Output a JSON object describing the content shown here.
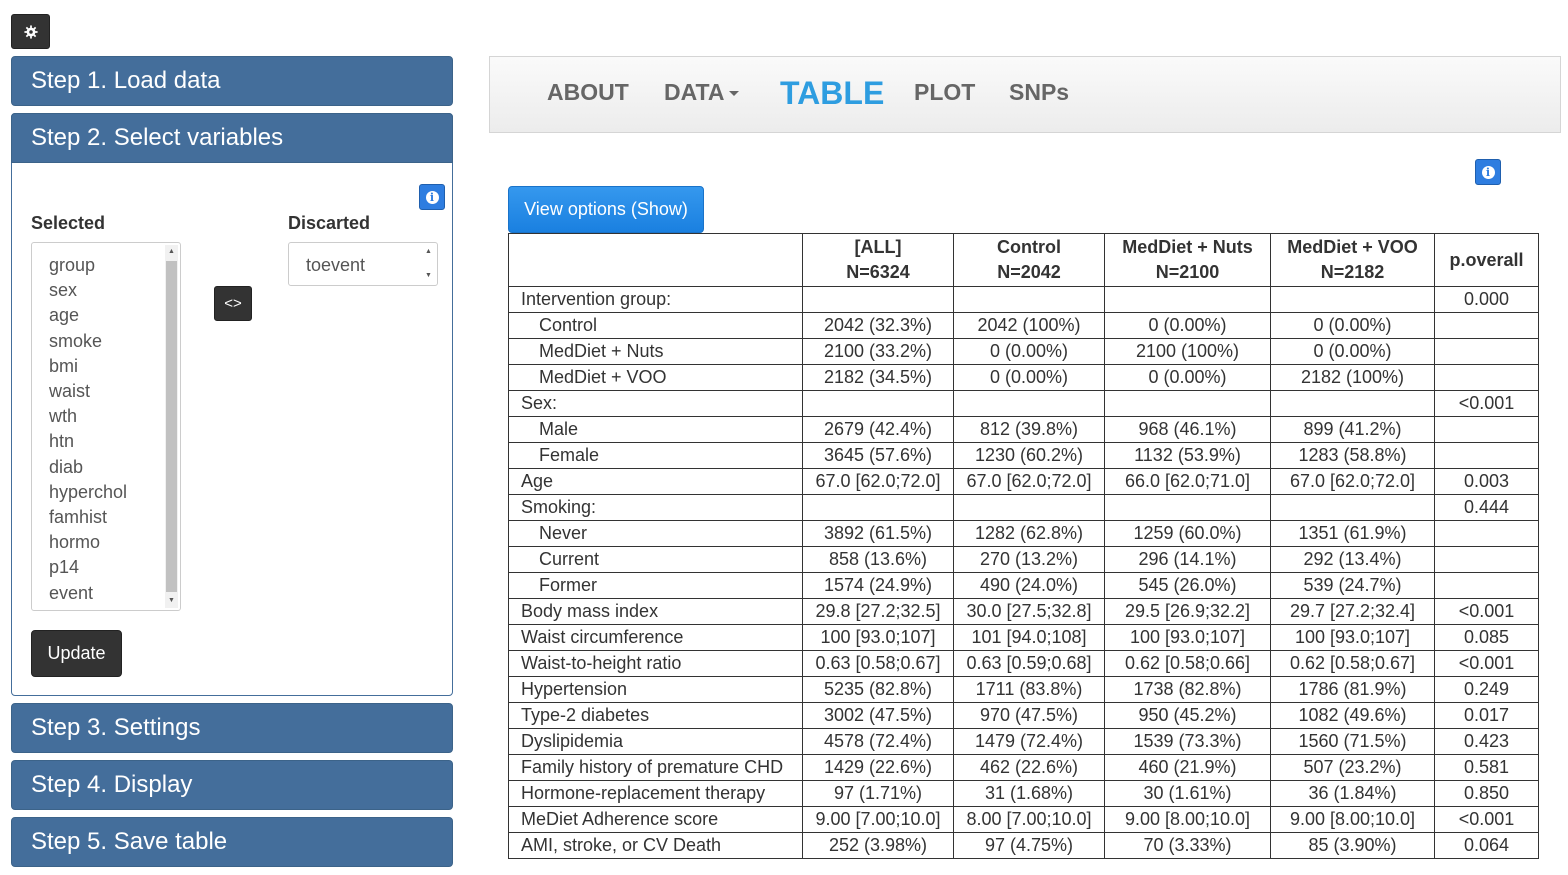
{
  "sidebar": {
    "steps": [
      "Step 1. Load data",
      "Step 2. Select variables",
      "Step 3. Settings",
      "Step 4. Display",
      "Step 5. Save table"
    ],
    "selected_label": "Selected",
    "discarded_label": "Discarted",
    "selected_items": [
      "group",
      "sex",
      "age",
      "smoke",
      "bmi",
      "waist",
      "wth",
      "htn",
      "diab",
      "hyperchol",
      "famhist",
      "hormo",
      "p14",
      "event"
    ],
    "discarded_items": [
      "toevent"
    ],
    "swap_label": "<>",
    "update_label": "Update"
  },
  "nav": {
    "items": [
      {
        "label": "ABOUT"
      },
      {
        "label": "DATA"
      },
      {
        "label": "TABLE",
        "active": true
      },
      {
        "label": "PLOT"
      },
      {
        "label": "SNPs"
      }
    ]
  },
  "main": {
    "view_options_label": "View options (Show)",
    "table": {
      "headers": [
        {
          "line1": "",
          "line2": ""
        },
        {
          "line1": "[ALL]",
          "line2": "N=6324"
        },
        {
          "line1": "Control",
          "line2": "N=2042"
        },
        {
          "line1": "MedDiet + Nuts",
          "line2": "N=2100"
        },
        {
          "line1": "MedDiet + VOO",
          "line2": "N=2182"
        },
        {
          "line1": "p.overall",
          "line2": ""
        }
      ],
      "rows": [
        {
          "label": "Intervention group:",
          "indent": false,
          "cells": [
            "",
            "",
            "",
            "",
            "0.000"
          ]
        },
        {
          "label": "Control",
          "indent": true,
          "cells": [
            "2042 (32.3%)",
            "2042 (100%)",
            "0 (0.00%)",
            "0 (0.00%)",
            ""
          ]
        },
        {
          "label": "MedDiet + Nuts",
          "indent": true,
          "cells": [
            "2100 (33.2%)",
            "0 (0.00%)",
            "2100 (100%)",
            "0 (0.00%)",
            ""
          ]
        },
        {
          "label": "MedDiet + VOO",
          "indent": true,
          "cells": [
            "2182 (34.5%)",
            "0 (0.00%)",
            "0 (0.00%)",
            "2182 (100%)",
            ""
          ]
        },
        {
          "label": "Sex:",
          "indent": false,
          "cells": [
            "",
            "",
            "",
            "",
            "<0.001"
          ]
        },
        {
          "label": "Male",
          "indent": true,
          "cells": [
            "2679 (42.4%)",
            "812 (39.8%)",
            "968 (46.1%)",
            "899 (41.2%)",
            ""
          ]
        },
        {
          "label": "Female",
          "indent": true,
          "cells": [
            "3645 (57.6%)",
            "1230 (60.2%)",
            "1132 (53.9%)",
            "1283 (58.8%)",
            ""
          ]
        },
        {
          "label": "Age",
          "indent": false,
          "cells": [
            "67.0 [62.0;72.0]",
            "67.0 [62.0;72.0]",
            "66.0 [62.0;71.0]",
            "67.0 [62.0;72.0]",
            "0.003"
          ]
        },
        {
          "label": "Smoking:",
          "indent": false,
          "cells": [
            "",
            "",
            "",
            "",
            "0.444"
          ]
        },
        {
          "label": "Never",
          "indent": true,
          "cells": [
            "3892 (61.5%)",
            "1282 (62.8%)",
            "1259 (60.0%)",
            "1351 (61.9%)",
            ""
          ]
        },
        {
          "label": "Current",
          "indent": true,
          "cells": [
            "858 (13.6%)",
            "270 (13.2%)",
            "296 (14.1%)",
            "292 (13.4%)",
            ""
          ]
        },
        {
          "label": "Former",
          "indent": true,
          "cells": [
            "1574 (24.9%)",
            "490 (24.0%)",
            "545 (26.0%)",
            "539 (24.7%)",
            ""
          ]
        },
        {
          "label": "Body mass index",
          "indent": false,
          "cells": [
            "29.8 [27.2;32.5]",
            "30.0 [27.5;32.8]",
            "29.5 [26.9;32.2]",
            "29.7 [27.2;32.4]",
            "<0.001"
          ]
        },
        {
          "label": "Waist circumference",
          "indent": false,
          "cells": [
            "100 [93.0;107]",
            "101 [94.0;108]",
            "100 [93.0;107]",
            "100 [93.0;107]",
            "0.085"
          ]
        },
        {
          "label": "Waist-to-height ratio",
          "indent": false,
          "cells": [
            "0.63 [0.58;0.67]",
            "0.63 [0.59;0.68]",
            "0.62 [0.58;0.66]",
            "0.62 [0.58;0.67]",
            "<0.001"
          ]
        },
        {
          "label": "Hypertension",
          "indent": false,
          "cells": [
            "5235 (82.8%)",
            "1711 (83.8%)",
            "1738 (82.8%)",
            "1786 (81.9%)",
            "0.249"
          ]
        },
        {
          "label": "Type-2 diabetes",
          "indent": false,
          "cells": [
            "3002 (47.5%)",
            "970 (47.5%)",
            "950 (45.2%)",
            "1082 (49.6%)",
            "0.017"
          ]
        },
        {
          "label": "Dyslipidemia",
          "indent": false,
          "cells": [
            "4578 (72.4%)",
            "1479 (72.4%)",
            "1539 (73.3%)",
            "1560 (71.5%)",
            "0.423"
          ]
        },
        {
          "label": "Family history of premature CHD",
          "indent": false,
          "cells": [
            "1429 (22.6%)",
            "462 (22.6%)",
            "460 (21.9%)",
            "507 (23.2%)",
            "0.581"
          ]
        },
        {
          "label": "Hormone-replacement therapy",
          "indent": false,
          "cells": [
            "97 (1.71%)",
            "31 (1.68%)",
            "30 (1.61%)",
            "36 (1.84%)",
            "0.850"
          ]
        },
        {
          "label": "MeDiet Adherence score",
          "indent": false,
          "cells": [
            "9.00 [7.00;10.0]",
            "8.00 [7.00;10.0]",
            "9.00 [8.00;10.0]",
            "9.00 [8.00;10.0]",
            "<0.001"
          ]
        },
        {
          "label": "AMI, stroke, or CV Death",
          "indent": false,
          "cells": [
            "252 (3.98%)",
            "97 (4.75%)",
            "70 (3.33%)",
            "85 (3.90%)",
            "0.064"
          ]
        }
      ]
    }
  },
  "colors": {
    "step_header": "#446e9b",
    "nav_active": "#2e9de0",
    "primary_button": "#1a80e0",
    "dark_button": "#333333"
  },
  "icons": {
    "settings": "gear-icon",
    "info": "info-icon",
    "dropdown": "caret-down-icon"
  }
}
